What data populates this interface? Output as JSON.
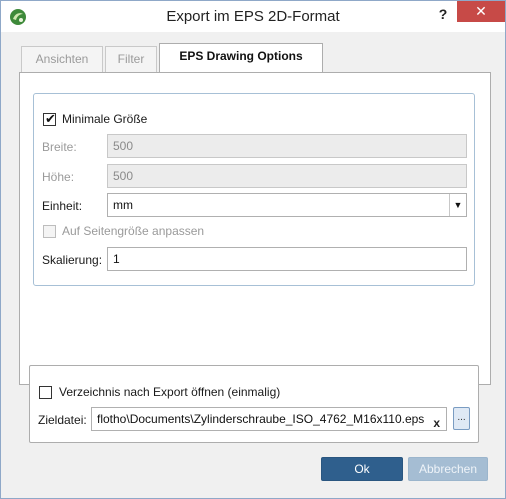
{
  "window": {
    "title": "Export im EPS 2D-Format",
    "help_label": "?",
    "close_label": "✕"
  },
  "tabs": [
    {
      "label": "Ansichten",
      "active": false
    },
    {
      "label": "Filter",
      "active": false
    },
    {
      "label": "EPS Drawing Options",
      "active": true
    }
  ],
  "options": {
    "minimal_size": {
      "label": "Minimale Größe",
      "checked": true
    },
    "width": {
      "label": "Breite:",
      "value": "500"
    },
    "height": {
      "label": "Höhe:",
      "value": "500"
    },
    "unit": {
      "label": "Einheit:",
      "value": "mm"
    },
    "fit_page": {
      "label": "Auf Seitengröße anpassen",
      "checked": false
    },
    "scaling": {
      "label": "Skalierung:",
      "value": "1"
    }
  },
  "export": {
    "open_dir": {
      "label": "Verzeichnis nach Export öffnen (einmalig)",
      "checked": false
    },
    "target_label": "Zieldatei:",
    "target_value": "flotho\\Documents\\Zylinderschraube_ISO_4762_M16x110.eps",
    "clear_label": "x",
    "browse_label": "..."
  },
  "buttons": {
    "ok": "Ok",
    "cancel": "Abbrechen"
  },
  "icons": {
    "app": "app-logo-icon",
    "check": "checkmark-icon",
    "dropdown": "chevron-down-icon"
  },
  "colors": {
    "primary_button": "#2f5f8d",
    "disabled_button": "#a5bdd3",
    "close_button": "#c74a47",
    "group_border": "#a7c0d6"
  }
}
